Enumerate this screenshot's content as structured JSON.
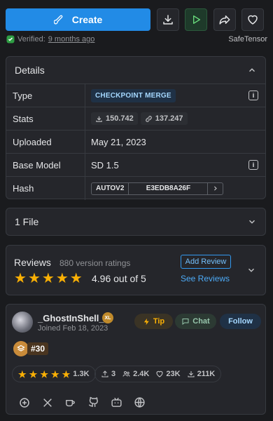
{
  "toolbar": {
    "create_label": "Create"
  },
  "verified": {
    "label": "Verified:",
    "date": "9 months ago"
  },
  "format": "SafeTensor",
  "details": {
    "title": "Details",
    "rows": [
      {
        "label": "Type",
        "value": "CHECKPOINT MERGE"
      },
      {
        "label": "Stats",
        "downloads": "150.742",
        "generations": "137.247"
      },
      {
        "label": "Uploaded",
        "value": "May 21, 2023"
      },
      {
        "label": "Base Model",
        "value": "SD 1.5"
      },
      {
        "label": "Hash",
        "hash_type": "AUTOV2",
        "hash_value": "E3EDB8A26F"
      }
    ]
  },
  "files": {
    "label": "1 File"
  },
  "reviews": {
    "title": "Reviews",
    "count": "880 version ratings",
    "rating": 4.96,
    "score_label": "4.96 out of 5",
    "add_label": "Add Review",
    "see_label": "See Reviews"
  },
  "creator": {
    "name": "_GhostInShell_",
    "level_badge": "XL",
    "joined": "Joined Feb 18, 2023",
    "tip_label": "Tip",
    "chat_label": "Chat",
    "follow_label": "Follow",
    "rank": "#30",
    "rating_count": "1.3K",
    "uploads": "3",
    "followers": "2.4K",
    "favorites": "23K",
    "downloads": "211K"
  },
  "colors": {
    "accent": "#228be6",
    "star": "#fab005",
    "background": "#1a1b1e",
    "card": "#25262b"
  }
}
